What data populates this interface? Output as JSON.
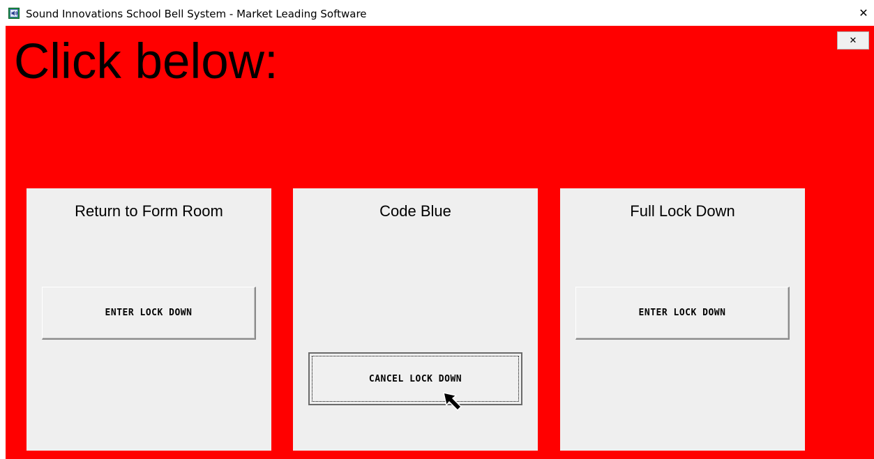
{
  "window": {
    "title": "Sound Innovations School Bell System - Market Leading Software",
    "close_glyph": "✕"
  },
  "main": {
    "heading": "Click below:",
    "close_glyph": "✕",
    "background_color": "#ff0000"
  },
  "panels": [
    {
      "title": "Return to Form Room",
      "button_label": "ENTER LOCK DOWN"
    },
    {
      "title": "Code Blue",
      "button_label": "CANCEL LOCK DOWN"
    },
    {
      "title": "Full Lock Down",
      "button_label": "ENTER LOCK DOWN"
    }
  ]
}
